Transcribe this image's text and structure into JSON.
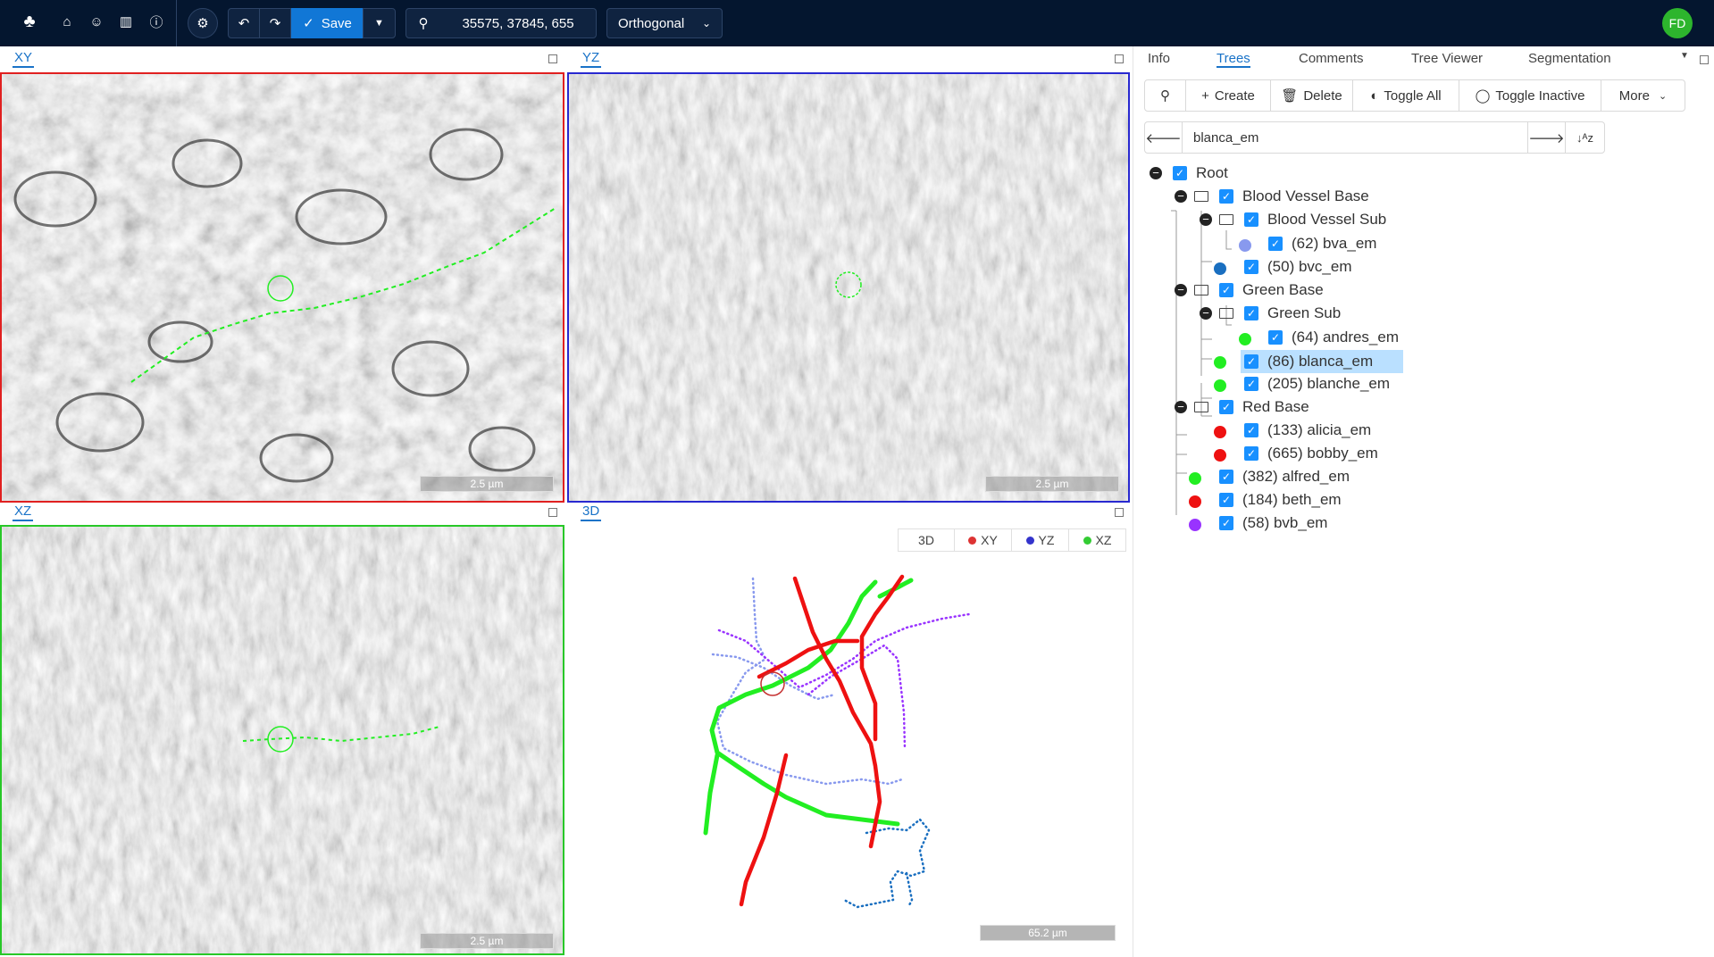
{
  "toolbar": {
    "save_label": "Save",
    "position": "35575, 37845, 655",
    "view_mode": "Orthogonal",
    "user_initials": "FD"
  },
  "viewports": {
    "xy": {
      "label": "XY",
      "scale": "2.5 µm"
    },
    "yz": {
      "label": "YZ",
      "scale": "2.5 µm"
    },
    "xz": {
      "label": "XZ",
      "scale": "2.5 µm"
    },
    "td": {
      "label": "3D",
      "scale": "65.2 µm",
      "legend": {
        "three_d": "3D",
        "xy": "XY",
        "yz": "YZ",
        "xz": "XZ"
      }
    }
  },
  "panel": {
    "tabs": [
      "Info",
      "Trees",
      "Comments",
      "Tree Viewer",
      "Segmentation"
    ],
    "active_tab": "Trees",
    "tools": {
      "create": "Create",
      "delete": "Delete",
      "toggle_all": "Toggle All",
      "toggle_inactive": "Toggle Inactive",
      "more": "More"
    },
    "active_tree_name": "blanca_em"
  },
  "tree": {
    "root": "Root",
    "groups": {
      "blood_vessel_base": "Blood Vessel Base",
      "blood_vessel_sub": "Blood Vessel Sub",
      "green_base": "Green Base",
      "green_sub": "Green Sub",
      "red_base": "Red Base"
    },
    "trees": {
      "bva": "(62) bva_em",
      "bvc": "(50) bvc_em",
      "andres": "(64) andres_em",
      "blanca": "(86) blanca_em",
      "blanche": "(205) blanche_em",
      "alicia": "(133) alicia_em",
      "bobby": "(665) bobby_em",
      "alfred": "(382) alfred_em",
      "beth": "(184) beth_em",
      "bvb": "(58) bvb_em"
    }
  },
  "colors": {
    "topbar": "#04162f",
    "accent": "#1890ff",
    "xy_border": "#e02020",
    "yz_border": "#2828d0",
    "xz_border": "#28c828",
    "green_tree": "#22ee22",
    "red_tree": "#ee1111",
    "lightblue_tree": "#8899ee",
    "blue_tree": "#1a6fc0",
    "purple_tree": "#9933ff"
  }
}
